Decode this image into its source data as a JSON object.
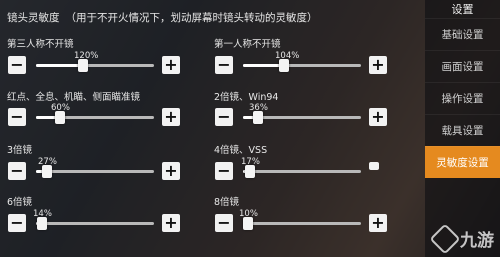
{
  "header": {
    "title": "镜头灵敏度",
    "subtitle": "（用于不开火情况下，划动屏幕时镜头转动的灵敏度）"
  },
  "sliders": [
    {
      "label": "第三人称不开镜",
      "value": "120%",
      "fraction": 0.4
    },
    {
      "label": "第一人称不开镜",
      "value": "104%",
      "fraction": 0.35
    },
    {
      "label": "红点、全息、机瞄、侧面瞄准镜",
      "value": "60%",
      "fraction": 0.2
    },
    {
      "label": "2倍镜、Win94",
      "value": "36%",
      "fraction": 0.13
    },
    {
      "label": "3倍镜",
      "value": "27%",
      "fraction": 0.09
    },
    {
      "label": "4倍镜、VSS",
      "value": "17%",
      "fraction": 0.06
    },
    {
      "label": "6倍镜",
      "value": "14%",
      "fraction": 0.05
    },
    {
      "label": "8倍镜",
      "value": "10%",
      "fraction": 0.04
    }
  ],
  "buttons": {
    "minus": "−",
    "plus": "+"
  },
  "sidebar": {
    "title": "设置",
    "items": [
      {
        "label": "基础设置"
      },
      {
        "label": "画面设置"
      },
      {
        "label": "操作设置"
      },
      {
        "label": "载具设置"
      },
      {
        "label": "灵敏度设置"
      }
    ],
    "active_index": 4,
    "accent": "#e58a1f"
  },
  "watermark": {
    "text": "九游"
  }
}
